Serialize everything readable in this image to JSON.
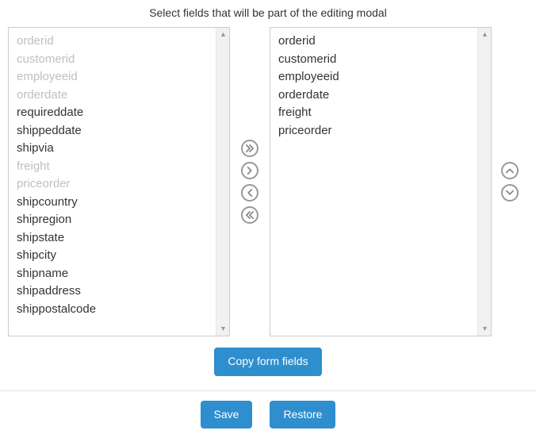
{
  "title": "Select fields that will be part of the editing modal",
  "available": [
    {
      "label": "orderid",
      "disabled": true
    },
    {
      "label": "customerid",
      "disabled": true
    },
    {
      "label": "employeeid",
      "disabled": true
    },
    {
      "label": "orderdate",
      "disabled": true
    },
    {
      "label": "requireddate",
      "disabled": false
    },
    {
      "label": "shippeddate",
      "disabled": false
    },
    {
      "label": "shipvia",
      "disabled": false
    },
    {
      "label": "freight",
      "disabled": true
    },
    {
      "label": "priceorder",
      "disabled": true
    },
    {
      "label": "shipcountry",
      "disabled": false
    },
    {
      "label": "shipregion",
      "disabled": false
    },
    {
      "label": "shipstate",
      "disabled": false
    },
    {
      "label": "shipcity",
      "disabled": false
    },
    {
      "label": "shipname",
      "disabled": false
    },
    {
      "label": "shipaddress",
      "disabled": false
    },
    {
      "label": "shippostalcode",
      "disabled": false
    }
  ],
  "selected": [
    {
      "label": "orderid"
    },
    {
      "label": "customerid"
    },
    {
      "label": "employeeid"
    },
    {
      "label": "orderdate"
    },
    {
      "label": "freight"
    },
    {
      "label": "priceorder"
    }
  ],
  "buttons": {
    "copy": "Copy form fields",
    "save": "Save",
    "restore": "Restore"
  }
}
